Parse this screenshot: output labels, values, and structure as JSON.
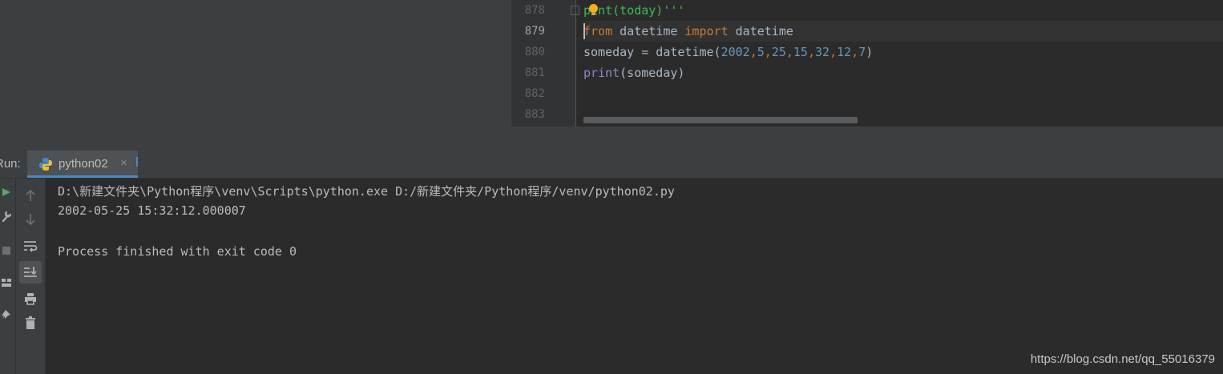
{
  "editor": {
    "line_numbers": [
      "878",
      "879",
      "880",
      "881",
      "882",
      "883"
    ],
    "lines": {
      "l878": {
        "text_a": "p",
        "text_b": "int(today)'''"
      },
      "l879": {
        "kw_from": "from",
        "mod": " datetime ",
        "kw_import": "import",
        "name": " datetime"
      },
      "l880": {
        "lhs": "someday = datetime(",
        "n1": "2002",
        "c1": ",",
        "n2": "5",
        "c2": ",",
        "n3": "25",
        "c3": ",",
        "n4": "15",
        "c4": ",",
        "n5": "32",
        "c5": ",",
        "n6": "12",
        "c6": ",",
        "n7": "7",
        "close": ")"
      },
      "l881": {
        "fn": "print",
        "args": "(someday)"
      }
    }
  },
  "run_panel": {
    "label": "Run:",
    "tab_label": "python02",
    "tab_close": "×"
  },
  "console": {
    "command": "D:\\新建文件夹\\Python程序\\venv\\Scripts\\python.exe D:/新建文件夹/Python程序/venv/python02.py",
    "output": "2002-05-25 15:32:12.000007",
    "exit_message": "Process finished with exit code 0"
  },
  "watermark": "https://blog.csdn.net/qq_55016379",
  "icons": {
    "left_toolbar": [
      "run-icon",
      "wrench-icon",
      "stop-icon",
      "layout-icon",
      "pin-icon"
    ],
    "right_toolbar": [
      "arrow-up-icon",
      "arrow-down-icon",
      "soft-wrap-icon",
      "scroll-to-end-icon",
      "print-icon",
      "trash-icon"
    ]
  },
  "colors": {
    "keyword": "#cc7832",
    "number": "#6897bb",
    "builtin": "#8888c6",
    "string": "#6a8759",
    "tab_accent": "#4a88c7",
    "run_green": "#59a869"
  }
}
